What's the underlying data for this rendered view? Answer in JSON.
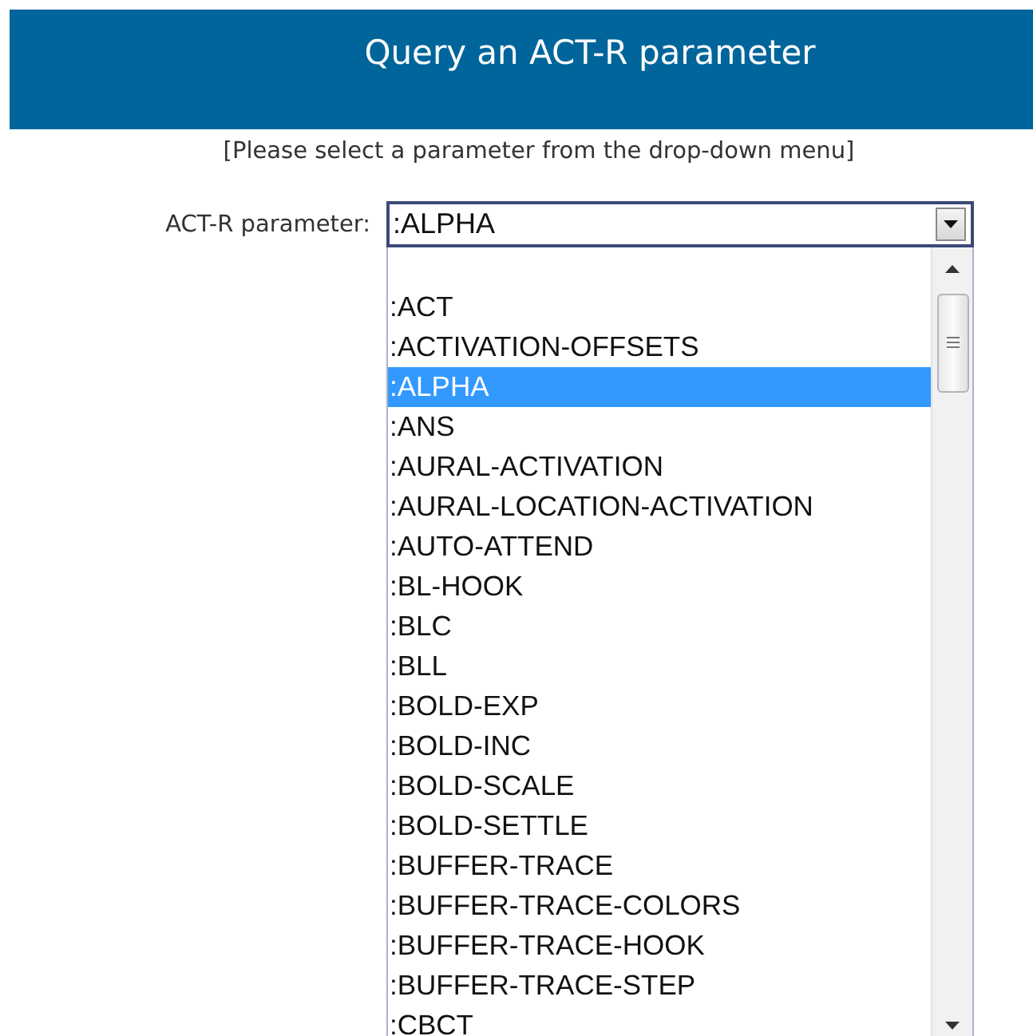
{
  "header": {
    "title": "Query an ACT-R parameter"
  },
  "hint": "[Please select a parameter from the drop-down menu]",
  "field": {
    "label": "ACT-R parameter:",
    "value": ":ALPHA"
  },
  "options": [
    {
      "label": ":ACT",
      "selected": false
    },
    {
      "label": ":ACTIVATION-OFFSETS",
      "selected": false
    },
    {
      "label": ":ALPHA",
      "selected": true
    },
    {
      "label": ":ANS",
      "selected": false
    },
    {
      "label": ":AURAL-ACTIVATION",
      "selected": false
    },
    {
      "label": ":AURAL-LOCATION-ACTIVATION",
      "selected": false
    },
    {
      "label": ":AUTO-ATTEND",
      "selected": false
    },
    {
      "label": ":BL-HOOK",
      "selected": false
    },
    {
      "label": ":BLC",
      "selected": false
    },
    {
      "label": ":BLL",
      "selected": false
    },
    {
      "label": ":BOLD-EXP",
      "selected": false
    },
    {
      "label": ":BOLD-INC",
      "selected": false
    },
    {
      "label": ":BOLD-SCALE",
      "selected": false
    },
    {
      "label": ":BOLD-SETTLE",
      "selected": false
    },
    {
      "label": ":BUFFER-TRACE",
      "selected": false
    },
    {
      "label": ":BUFFER-TRACE-COLORS",
      "selected": false
    },
    {
      "label": ":BUFFER-TRACE-HOOK",
      "selected": false
    },
    {
      "label": ":BUFFER-TRACE-STEP",
      "selected": false
    },
    {
      "label": ":CBCT",
      "selected": false
    }
  ]
}
